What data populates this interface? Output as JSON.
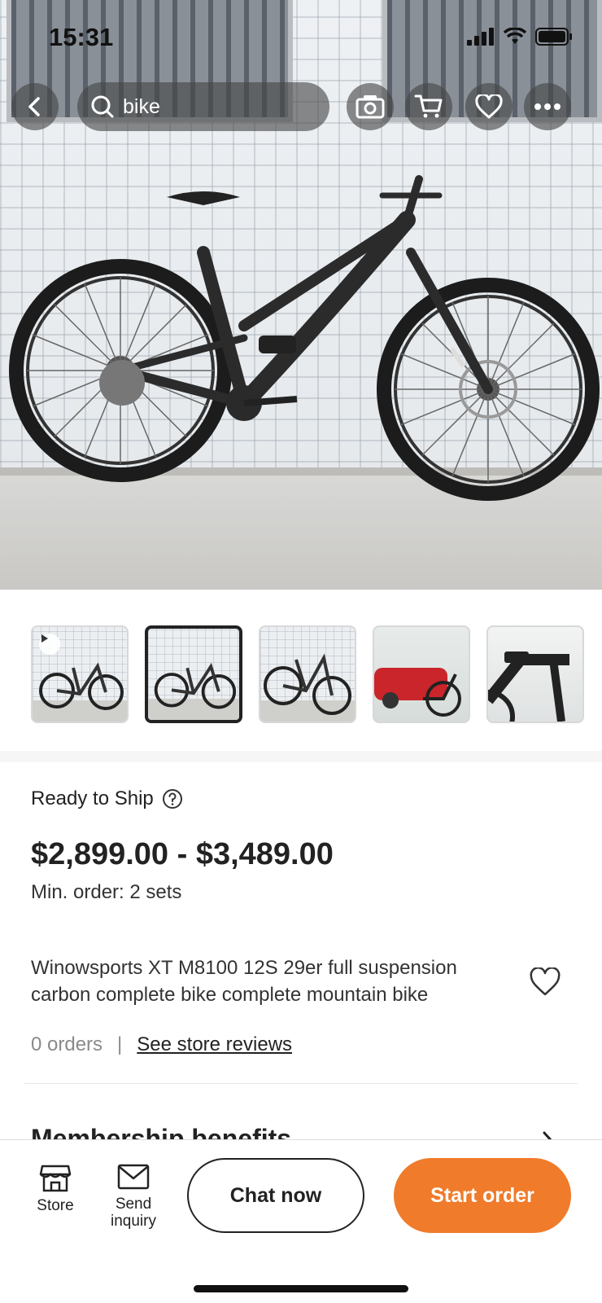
{
  "status_bar": {
    "time": "15:31"
  },
  "nav": {
    "search_query": "bike",
    "icons": [
      "back-icon",
      "search-icon",
      "camera-icon",
      "cart-icon",
      "heart-icon",
      "more-icon"
    ]
  },
  "gallery": {
    "thumbnail_count": 5,
    "selected_index": 1
  },
  "product": {
    "ready_to_ship": "Ready to Ship",
    "price": "$2,899.00 - $3,489.00",
    "min_order": "Min. order: 2 sets",
    "title": "Winowsports XT M8100 12S 29er full suspension carbon complete bike complete mountain bike",
    "orders": "0 orders",
    "separator": "|",
    "reviews_link": "See store reviews",
    "section_title": "Membership benefits"
  },
  "bottom_bar": {
    "store_label": "Store",
    "inquiry_label": "Send inquiry",
    "chat_label": "Chat now",
    "start_label": "Start order",
    "accent": "#f07b2a"
  }
}
